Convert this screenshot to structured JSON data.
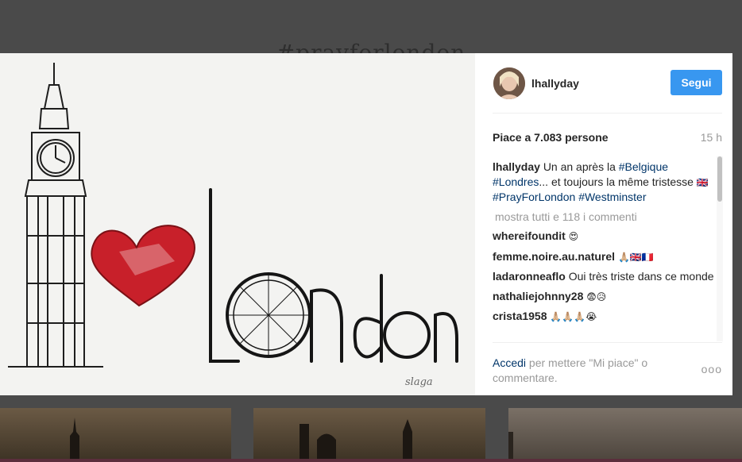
{
  "background": {
    "hashtag": "#prayforlondon"
  },
  "post": {
    "username": "lhallyday",
    "follow_label": "Segui",
    "likes": "Piace a 7.083 persone",
    "time": "15 h",
    "caption": {
      "user": "lhallyday",
      "text_1": "Un an après la ",
      "tag_1": "#Belgique",
      "tag_2": "#Londres",
      "text_2": "... et toujours la même tristesse",
      "flag": "🇬🇧",
      "tag_3": "#PrayForLondon",
      "tag_4": "#Westminster"
    },
    "view_all": "mostra tutti e 118 i commenti",
    "comments": [
      {
        "user": "whereifoundit",
        "text": "😍"
      },
      {
        "user": "femme.noire.au.naturel",
        "text": "🙏🏼🇬🇧🇫🇷"
      },
      {
        "user": "ladaronneaflo",
        "text": "Oui très triste dans ce monde"
      },
      {
        "user": "nathaliejohnny28",
        "text": "😨😥"
      },
      {
        "user": "crista1958",
        "text": "🙏🏼🙏🏼🙏🏼😭"
      }
    ],
    "footer": {
      "login": "Accedi",
      "rest": " per mettere \"Mi piace\" o commentare.",
      "more": "ooo"
    }
  },
  "colors": {
    "follow_button": "#3897f0",
    "hashtag_link": "#003569"
  }
}
